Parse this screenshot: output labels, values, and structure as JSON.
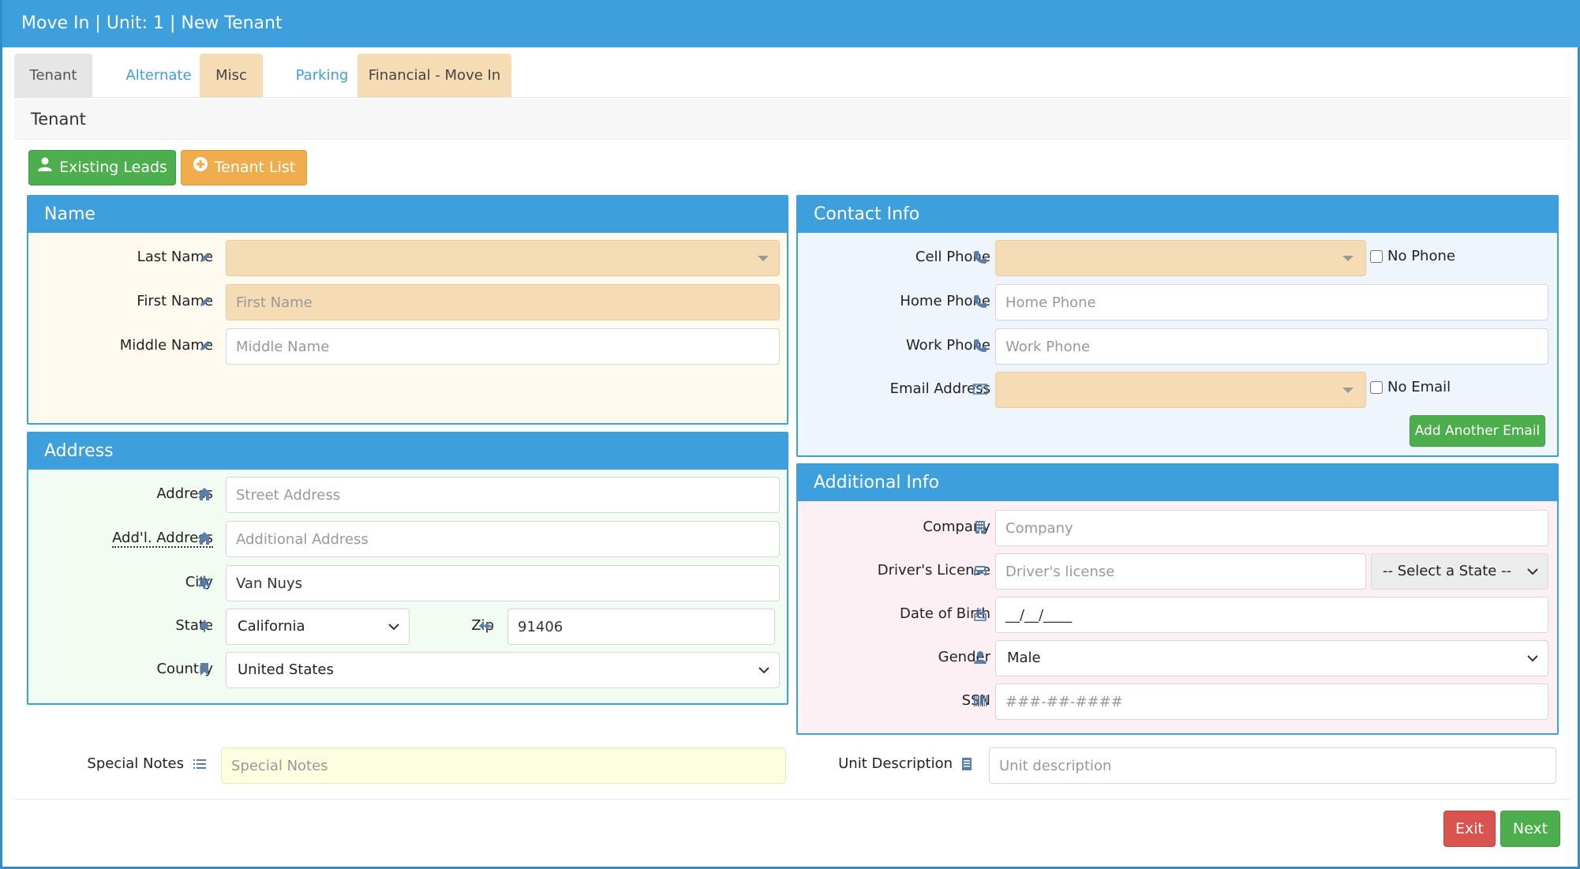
{
  "window": {
    "title": "Move In | Unit: 1 | New Tenant"
  },
  "tabs": [
    {
      "label": "Tenant"
    },
    {
      "label": "Alternate"
    },
    {
      "label": "Misc"
    },
    {
      "label": "Parking"
    },
    {
      "label": "Financial - Move In"
    }
  ],
  "section": {
    "title": "Tenant"
  },
  "actions": {
    "existing_leads": "Existing Leads",
    "tenant_list": "Tenant List"
  },
  "name_panel": {
    "title": "Name",
    "last_name_label": "Last Name",
    "last_name_value": "",
    "first_name_label": "First Name",
    "first_name_placeholder": "First Name",
    "middle_name_label": "Middle Name",
    "middle_name_placeholder": "Middle Name"
  },
  "address_panel": {
    "title": "Address",
    "address_label": "Address",
    "address_placeholder": "Street Address",
    "addl_address_label": "Add'l. Address",
    "addl_address_placeholder": "Additional Address",
    "city_label": "City",
    "city_value": "Van Nuys",
    "state_label": "State",
    "state_value": "California",
    "zip_label": "Zip",
    "zip_value": "91406",
    "country_label": "Country",
    "country_value": "United States"
  },
  "contact_panel": {
    "title": "Contact Info",
    "cell_phone_label": "Cell Phone",
    "cell_phone_value": "",
    "no_phone_label": "No Phone",
    "home_phone_label": "Home Phone",
    "home_phone_placeholder": "Home Phone",
    "work_phone_label": "Work Phone",
    "work_phone_placeholder": "Work Phone",
    "email_label": "Email Address",
    "email_value": "",
    "no_email_label": "No Email",
    "add_email_button": "Add Another Email"
  },
  "additional_panel": {
    "title": "Additional Info",
    "company_label": "Company",
    "company_placeholder": "Company",
    "license_label": "Driver's License",
    "license_placeholder": "Driver's license",
    "license_state_value": "-- Select a State --",
    "dob_label": "Date of Birth",
    "dob_value": "__/__/____",
    "gender_label": "Gender",
    "gender_value": "Male",
    "ssn_label": "SSN",
    "ssn_placeholder": "###-##-####"
  },
  "notes": {
    "special_notes_label": "Special Notes",
    "special_notes_placeholder": "Special Notes",
    "unit_description_label": "Unit Description",
    "unit_description_placeholder": "Unit description"
  },
  "footer": {
    "exit_label": "Exit",
    "next_label": "Next"
  },
  "colors": {
    "header_blue": "#3d9fdb",
    "required_peach": "#f5dcb4",
    "success_green": "#4cae4c",
    "warning_orange": "#f0ad4e",
    "danger_red": "#d9534f"
  },
  "icons": {
    "name_fields": "pencil-icon",
    "address": "home-icon",
    "city": "asterisk-icon",
    "state": "tree-icon",
    "zip": "reply-all-icon",
    "country": "bookmark-icon",
    "phones": "phone-icon",
    "email": "envelope-icon",
    "company": "building-icon",
    "license": "car-icon",
    "dob": "cake-icon",
    "gender": "user-icon",
    "ssn": "barcode-icon",
    "special_notes": "list-icon",
    "unit_description": "document-icon"
  }
}
